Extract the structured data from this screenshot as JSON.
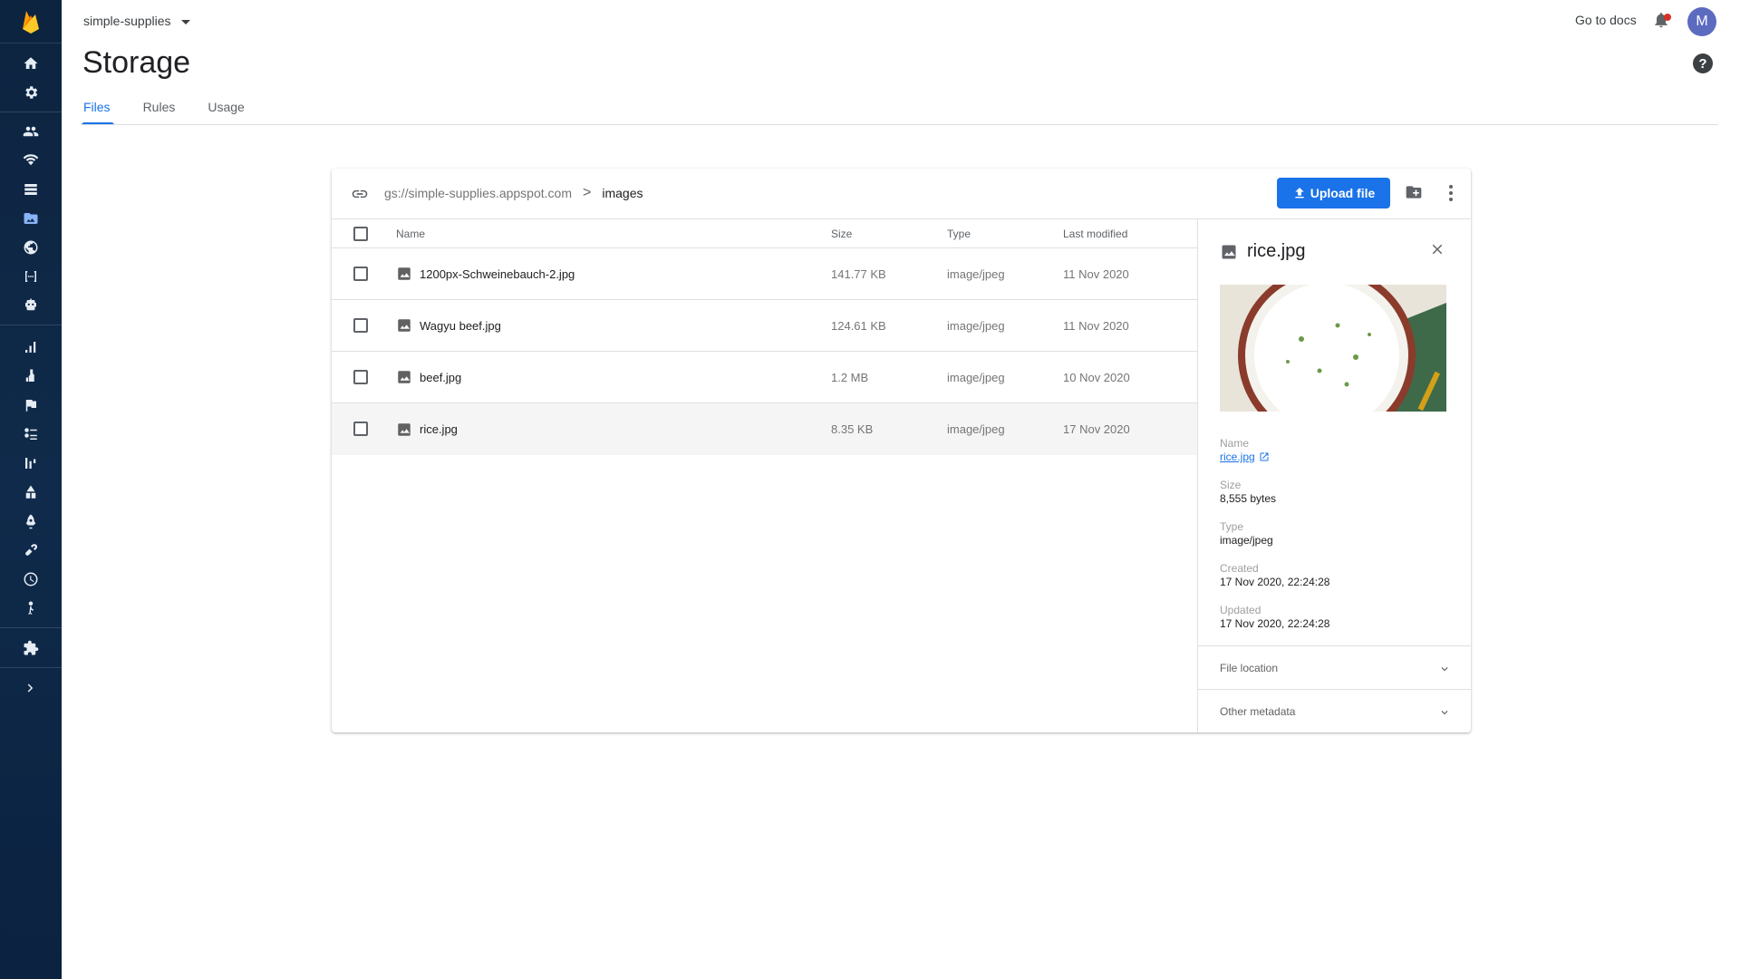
{
  "header": {
    "project_name": "simple-supplies",
    "go_to_docs": "Go to docs",
    "avatar_initial": "M",
    "help_symbol": "?"
  },
  "page": {
    "title": "Storage",
    "tabs": [
      {
        "label": "Files",
        "active": true
      },
      {
        "label": "Rules",
        "active": false
      },
      {
        "label": "Usage",
        "active": false
      }
    ]
  },
  "sidebar": {
    "icons": [
      "firebase-logo",
      "home-icon",
      "settings-icon",
      "authentication-icon",
      "realtime-database-icon",
      "firestore-icon",
      "storage-icon",
      "hosting-icon",
      "functions-icon",
      "ml-icon",
      "analytics-icon",
      "crashlytics-icon",
      "remote-config-icon",
      "predictions-icon",
      "ab-testing-icon",
      "app-distribution-icon",
      "performance-icon",
      "dynamic-links-icon",
      "test-lab-icon",
      "in-app-messaging-icon",
      "extensions-icon",
      "expand-icon"
    ],
    "colors": {
      "background": "#0f2a4a",
      "icon": "#e6ecf4",
      "logo": "#ffa000"
    }
  },
  "toolbar": {
    "bucket_path": "gs://simple-supplies.appspot.com",
    "path_separator": ">",
    "current_folder": "images",
    "upload_label": "Upload file"
  },
  "table": {
    "headers": {
      "name": "Name",
      "size": "Size",
      "type": "Type",
      "last_modified": "Last modified"
    },
    "rows": [
      {
        "name": "1200px-Schweinebauch-2.jpg",
        "size": "141.77 KB",
        "type": "image/jpeg",
        "last_modified": "11 Nov 2020"
      },
      {
        "name": "Wagyu beef.jpg",
        "size": "124.61 KB",
        "type": "image/jpeg",
        "last_modified": "11 Nov 2020"
      },
      {
        "name": "beef.jpg",
        "size": "1.2 MB",
        "type": "image/jpeg",
        "last_modified": "10 Nov 2020"
      },
      {
        "name": "rice.jpg",
        "size": "8.35 KB",
        "type": "image/jpeg",
        "last_modified": "17 Nov 2020"
      }
    ]
  },
  "details": {
    "title": "rice.jpg",
    "name_label": "Name",
    "name_value": "rice.jpg",
    "size_label": "Size",
    "size_value": "8,555 bytes",
    "type_label": "Type",
    "type_value": "image/jpeg",
    "created_label": "Created",
    "created_value": "17 Nov 2020, 22:24:28",
    "updated_label": "Updated",
    "updated_value": "17 Nov 2020, 22:24:28",
    "file_location_label": "File location",
    "other_metadata_label": "Other metadata"
  },
  "colors": {
    "accent": "#1a73e8",
    "notification_dot": "#d93025",
    "avatar_bg": "#5c6bc0"
  }
}
